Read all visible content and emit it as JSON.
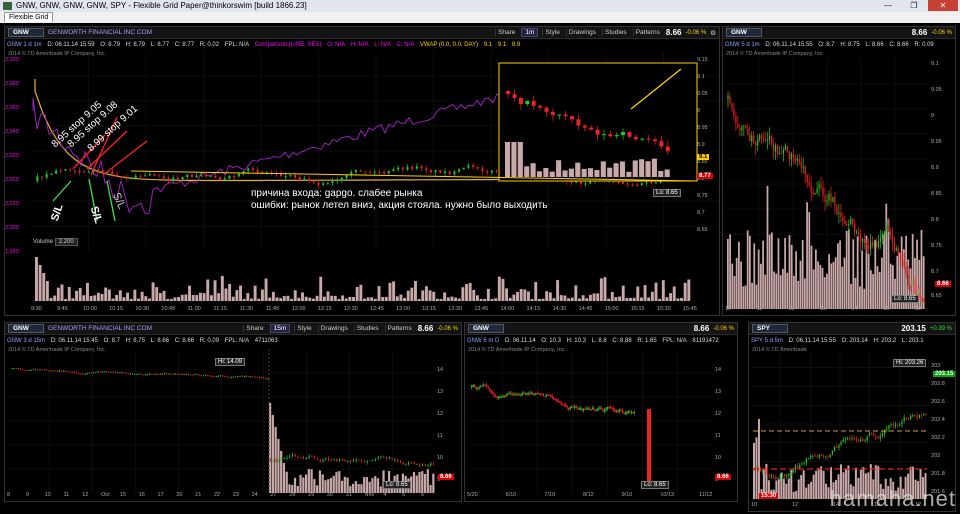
{
  "window": {
    "title": "GNW, GNW, GNW, GNW, SPY - Flexible Grid Paper@thinkorswim [build 1866.23]",
    "tab": "Flexible Grid",
    "buttons": [
      "—",
      "❐",
      "✕"
    ]
  },
  "main": {
    "symbol": "GNW",
    "company": "GENWORTH FINANCIAL INC COM",
    "header_row": [
      "GNW 1 d 1m",
      "D: 06.11.14 15:59",
      "O: 8.79",
      "H: 8.79",
      "L: 8.77",
      "C: 8.77",
      "R: 0.02",
      "FPL: N/A"
    ],
    "comparison": [
      "Comparison (LINE, SEX)",
      "O: N/A",
      "H: N/A",
      "L: N/A",
      "C: N/A"
    ],
    "vwap": [
      "VWAP (0.0, 0.0, DAY)",
      "9.1",
      "9.1",
      "8.9"
    ],
    "copyright": "2014 © TD Ameritrade IP Company, Inc.",
    "last_price_tag": "8.77",
    "vwap_tag": "9.1",
    "low_label": "Lo: 8.65",
    "y_ticks_left": [
      "2,100",
      "2,080",
      "2,060",
      "2,040",
      "2,030",
      "2,020",
      "2,010",
      "2,000",
      "1,990"
    ],
    "y_ticks_right": [
      "9.15",
      "9.1",
      "9.05",
      "9",
      "8.95",
      "8.9",
      "8.85",
      "8.8",
      "8.75",
      "8.7",
      "8.65"
    ],
    "x_ticks": [
      "9:30",
      "9:45",
      "10:00",
      "10:15",
      "10:30",
      "10:45",
      "11:00",
      "11:15",
      "11:30",
      "11:45",
      "12:00",
      "12:15",
      "12:30",
      "12:45",
      "13:00",
      "13:15",
      "13:30",
      "13:45",
      "14:00",
      "14:15",
      "14:30",
      "14:45",
      "15:00",
      "15:15",
      "15:30",
      "15:45"
    ],
    "volume_label": "Volume",
    "volume_value": "2,200",
    "annotation_line1": "причина входа: gapgo. слабее рынка",
    "annotation_line2": "ошибки: рынок летел вниз, акция стояла. нужно было выходить",
    "stops": [
      "8.95 stop 9.05",
      "8.95 stop 9.08",
      "8.99 stop 9.01"
    ],
    "sl_marks": [
      "S/L",
      "S/L",
      "S/L"
    ],
    "toolbar": {
      "share": "Share",
      "timeframe": "1m",
      "style": "Style",
      "drawings": "Drawings",
      "studies": "Studies",
      "patterns": "Patterns",
      "price": "8.66",
      "pct": "-0.06 %"
    }
  },
  "right_top": {
    "symbol": "GNW",
    "header_row": [
      "GNW 5 d 1m",
      "D: 06.11.14 15:55",
      "O: 8.7",
      "H: 8.75",
      "L: 8.66",
      "C: 8.66",
      "R: 0.09"
    ],
    "copyright": "2014 © TD Ameritrade IP Company, Inc.",
    "price": "8.66",
    "pct": "-0.06 %",
    "tag": "8.66",
    "low_label": "Lo: 8.65",
    "y_ticks": [
      "9.1",
      "9.05",
      "9",
      "8.95",
      "8.9",
      "8.85",
      "8.8",
      "8.75",
      "8.7",
      "8.65"
    ],
    "x_ticks": [
      "10",
      "11",
      "12",
      "13",
      "14",
      "15",
      "10"
    ]
  },
  "bottom_left": {
    "symbol": "GNW",
    "company": "GENWORTH FINANCIAL INC COM",
    "header_row": [
      "GNW 3 d 15m",
      "D: 06.11.14 15:45",
      "O: 8.7",
      "H: 8.75",
      "L: 8.66",
      "C: 8.66",
      "R: 0.09",
      "FPL: N/A"
    ],
    "volume_value": "4711063",
    "copyright": "2014 © TD Ameritrade IP Company, Inc.",
    "toolbar": {
      "share": "Share",
      "timeframe": "15m",
      "style": "Style",
      "drawings": "Drawings",
      "studies": "Studies",
      "patterns": "Patterns",
      "price": "8.66",
      "pct": "-0.06 %"
    },
    "hi_label": "Hi: 14.09",
    "low_label": "Lo: 8.65",
    "tag": "8.66",
    "y_ticks": [
      "14",
      "13",
      "12",
      "11",
      "10",
      "9"
    ],
    "x_ticks": [
      "8",
      "9",
      "10",
      "11",
      "12",
      "Oct",
      "15",
      "16",
      "17",
      "20",
      "21",
      "22",
      "23",
      "24",
      "27",
      "28",
      "29",
      "30",
      "31",
      "Nov",
      "4",
      "5",
      "6"
    ]
  },
  "bottom_mid": {
    "symbol": "GNW",
    "header_row": [
      "GNW 6 m D",
      "D: 06.11.14",
      "O: 10.3",
      "H: 10.3",
      "L: 8.8",
      "C: 8.88",
      "R: 1.65",
      "FPL: N/A"
    ],
    "volume_value": "81191472",
    "copyright": "2014 © TD Ameritrade IP Company, Inc.",
    "price": "8.66",
    "pct": "-0.06 %",
    "tag": "8.66",
    "low_label": "Lo: 8.65",
    "y_ticks": [
      "14",
      "13",
      "12",
      "11",
      "10",
      "9"
    ],
    "x_ticks": [
      "5/20",
      "6/10",
      "7/10",
      "8/12",
      "9/10",
      "10/13",
      "11/12"
    ]
  },
  "bottom_right": {
    "symbol": "SPY",
    "header_row": [
      "SPY 5 d 5m",
      "D: 06.11.14 15:55",
      "O: 203.14",
      "H: 203.2",
      "L: 203.1"
    ],
    "copyright": "2014 © TD Ameritrade",
    "price": "203.15",
    "pct": "+0.39 %",
    "hi_label": "Hi: 203.26",
    "tag": "203.15",
    "time_tag": "15:30",
    "y_ticks": [
      "203",
      "202.8",
      "202.6",
      "202.4",
      "202.2",
      "202",
      "201.8",
      "201.6"
    ],
    "x_ticks": [
      "10",
      "12",
      "14",
      "10",
      "12"
    ]
  },
  "watermark": "hamaha.net",
  "colors": {
    "up": "#22cc22",
    "down": "#ee2222",
    "volume": "#c8a8a8",
    "vwap": "#e0b030",
    "comparison": "#aa22cc",
    "yellow_line": "#ffd000",
    "background": "#000000"
  }
}
